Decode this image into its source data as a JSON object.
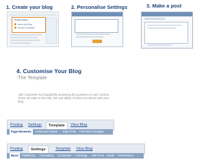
{
  "steps": {
    "step1": "1. Create your blog",
    "step2": "2. Personalise Settings",
    "step3": "3. Make a post",
    "step4": "4. Customise Your Blog"
  },
  "customise": {
    "subtitle": "-The Template",
    "description": "=Blir Customise by thoughtfully answering the questions in each section. These all relate to the look, feel and ability of others to interact with your blog."
  },
  "thumb1": {
    "callout": [
      "Create a blog →",
      "name your blog",
      "choose a template"
    ]
  },
  "tabbar1": {
    "tabs": [
      "Posting",
      "Settings",
      "Template",
      "View Blog"
    ],
    "active_tab": "Template",
    "subtabs": [
      "Page Elements",
      "Fonts and Colors",
      "Edit HTML",
      "Pick New Template"
    ],
    "active_subtab": "Page Elements"
  },
  "tabbar2": {
    "tabs": [
      "Posting",
      "Settings",
      "Template",
      "View Blog"
    ],
    "active_tab": "Settings",
    "subtabs": [
      "Basic",
      "Publishing",
      "Formatting",
      "Comments",
      "Archiving",
      "Site Feed",
      "Email",
      "Permissions"
    ],
    "active_subtab": "Basic"
  },
  "colors": {
    "title": "#1f3f7a",
    "link": "#1f4f9a",
    "highlight": "#e08a2a"
  }
}
